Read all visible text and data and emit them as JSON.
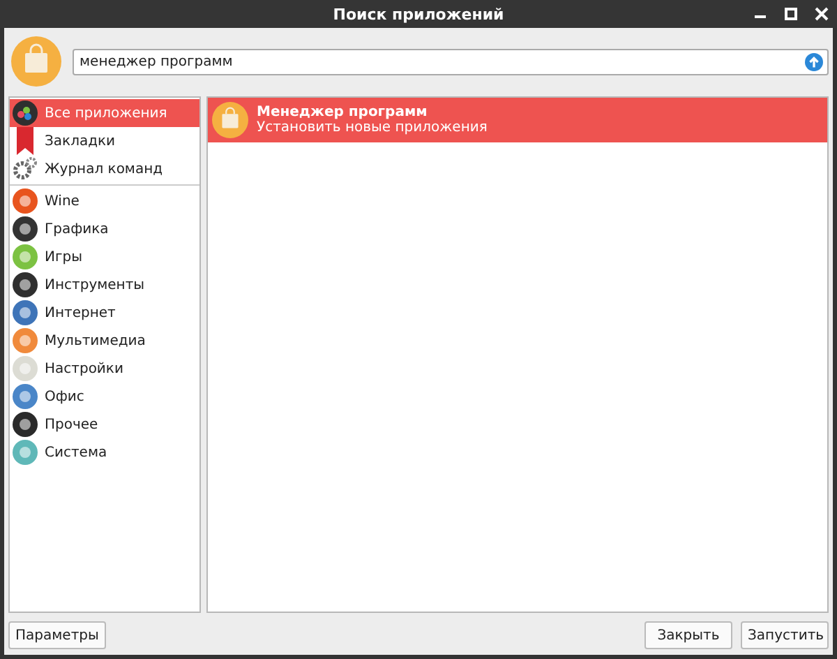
{
  "window": {
    "title": "Поиск приложений"
  },
  "search": {
    "value": "менеджер программ"
  },
  "sidebar": {
    "places": [
      {
        "label": "Все приложения",
        "kind": "all",
        "selected": true
      },
      {
        "label": "Закладки",
        "kind": "bookmark",
        "selected": false
      },
      {
        "label": "Журнал команд",
        "kind": "history",
        "selected": false
      }
    ],
    "categories": [
      {
        "label": "Wine",
        "color": "#e8541e",
        "selected": false
      },
      {
        "label": "Графика",
        "color": "#333333",
        "selected": false
      },
      {
        "label": "Игры",
        "color": "#7cc242",
        "selected": false
      },
      {
        "label": "Инструменты",
        "color": "#2f2f2f",
        "selected": false
      },
      {
        "label": "Интернет",
        "color": "#3e74b8",
        "selected": false
      },
      {
        "label": "Мультимедиа",
        "color": "#f08a3c",
        "selected": false
      },
      {
        "label": "Настройки",
        "color": "#dcdcd4",
        "selected": false
      },
      {
        "label": "Офис",
        "color": "#4a86c8",
        "selected": false
      },
      {
        "label": "Прочее",
        "color": "#2a2a2a",
        "selected": false
      },
      {
        "label": "Система",
        "color": "#5fb8b8",
        "selected": false
      }
    ]
  },
  "results": [
    {
      "name": "Менеджер программ",
      "description": "Установить новые приложения",
      "selected": true
    }
  ],
  "buttons": {
    "left": "Параметры",
    "right": [
      "Закрыть",
      "Запустить"
    ]
  }
}
